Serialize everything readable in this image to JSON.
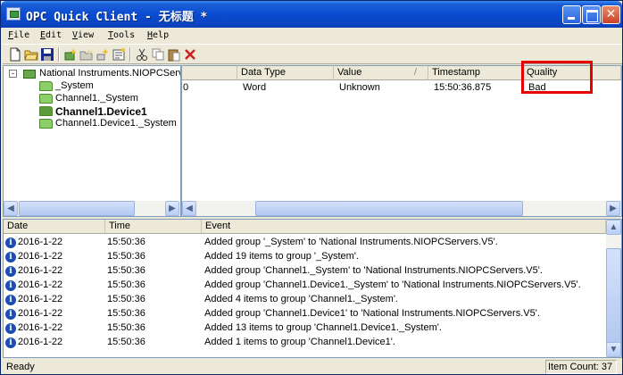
{
  "window": {
    "title": "OPC Quick Client - 无标题 *"
  },
  "menu": [
    "File",
    "Edit",
    "View",
    "Tools",
    "Help"
  ],
  "toolbar": {
    "icons": [
      "new-icon",
      "open-icon",
      "save-icon",
      "new-server-icon",
      "new-group-icon",
      "new-item-icon",
      "properties-icon",
      "cut-icon",
      "copy-icon",
      "paste-icon",
      "delete-icon"
    ]
  },
  "tree": {
    "root": "National Instruments.NIOPCServers.\\",
    "root_expander": "-",
    "children": [
      "_System",
      "Channel1._System",
      "Channel1.Device1",
      "Channel1.Device1._System"
    ],
    "selected": "Channel1.Device1"
  },
  "items": {
    "columns": [
      "",
      "Data Type",
      "Value",
      "Timestamp",
      "Quality"
    ],
    "sort_indicator": "/",
    "rows": [
      {
        "id": "0",
        "data_type": "Word",
        "value": "Unknown",
        "timestamp": "15:50:36.875",
        "quality": "Bad"
      }
    ]
  },
  "log": {
    "columns": [
      "Date",
      "Time",
      "Event"
    ],
    "rows": [
      {
        "date": "2016-1-22",
        "time": "15:50:36",
        "event": "Added group '_System' to 'National Instruments.NIOPCServers.V5'."
      },
      {
        "date": "2016-1-22",
        "time": "15:50:36",
        "event": "Added 19 items to group '_System'."
      },
      {
        "date": "2016-1-22",
        "time": "15:50:36",
        "event": "Added group 'Channel1._System' to 'National Instruments.NIOPCServers.V5'."
      },
      {
        "date": "2016-1-22",
        "time": "15:50:36",
        "event": "Added group 'Channel1.Device1._System' to 'National Instruments.NIOPCServers.V5'."
      },
      {
        "date": "2016-1-22",
        "time": "15:50:36",
        "event": "Added 4 items to group 'Channel1._System'."
      },
      {
        "date": "2016-1-22",
        "time": "15:50:36",
        "event": "Added group 'Channel1.Device1' to 'National Instruments.NIOPCServers.V5'."
      },
      {
        "date": "2016-1-22",
        "time": "15:50:36",
        "event": "Added 13 items to group 'Channel1.Device1._System'."
      },
      {
        "date": "2016-1-22",
        "time": "15:50:36",
        "event": "Added 1 items to group 'Channel1.Device1'."
      }
    ]
  },
  "status": {
    "text": "Ready",
    "item_count": "Item Count: 37"
  },
  "colors": {
    "highlight": "#e60000",
    "title_bar": "#0a4bd0",
    "info": "#1c4fb0"
  }
}
